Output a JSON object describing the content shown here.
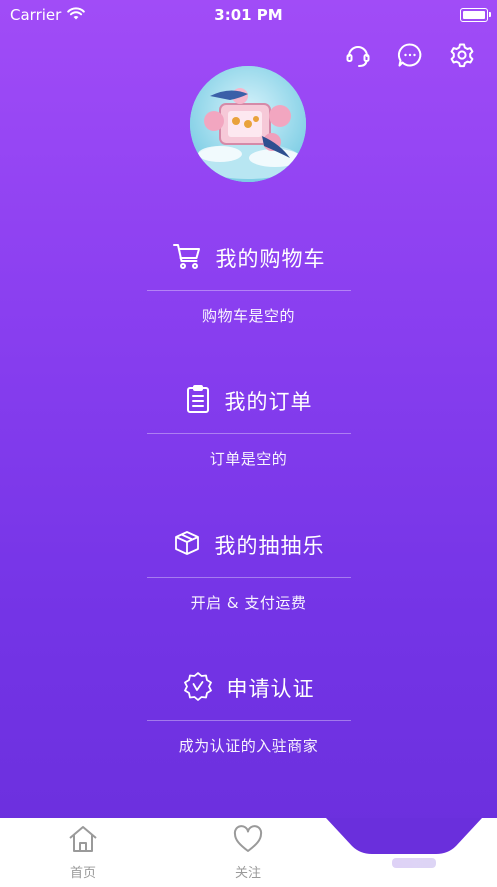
{
  "status_bar": {
    "carrier": "Carrier",
    "time": "3:01 PM"
  },
  "top_actions": {
    "icons": [
      "headset-icon",
      "chat-bubble-icon",
      "gear-icon"
    ]
  },
  "sections": [
    {
      "title": "我的购物车",
      "subtitle": "购物车是空的",
      "icon": "cart-icon"
    },
    {
      "title": "我的订单",
      "subtitle": "订单是空的",
      "icon": "clipboard-icon"
    },
    {
      "title": "我的抽抽乐",
      "subtitle": "开启 & 支付运费",
      "icon": "box-icon"
    },
    {
      "title": "申请认证",
      "subtitle": "成为认证的入驻商家",
      "icon": "badge-check-icon"
    }
  ],
  "tabbar": {
    "home_label": "首页",
    "follow_label": "关注"
  },
  "colors": {
    "gradient_top": "#a14cf7",
    "gradient_bottom": "#6a2fdc",
    "tab_inactive": "#9a9a9a"
  }
}
